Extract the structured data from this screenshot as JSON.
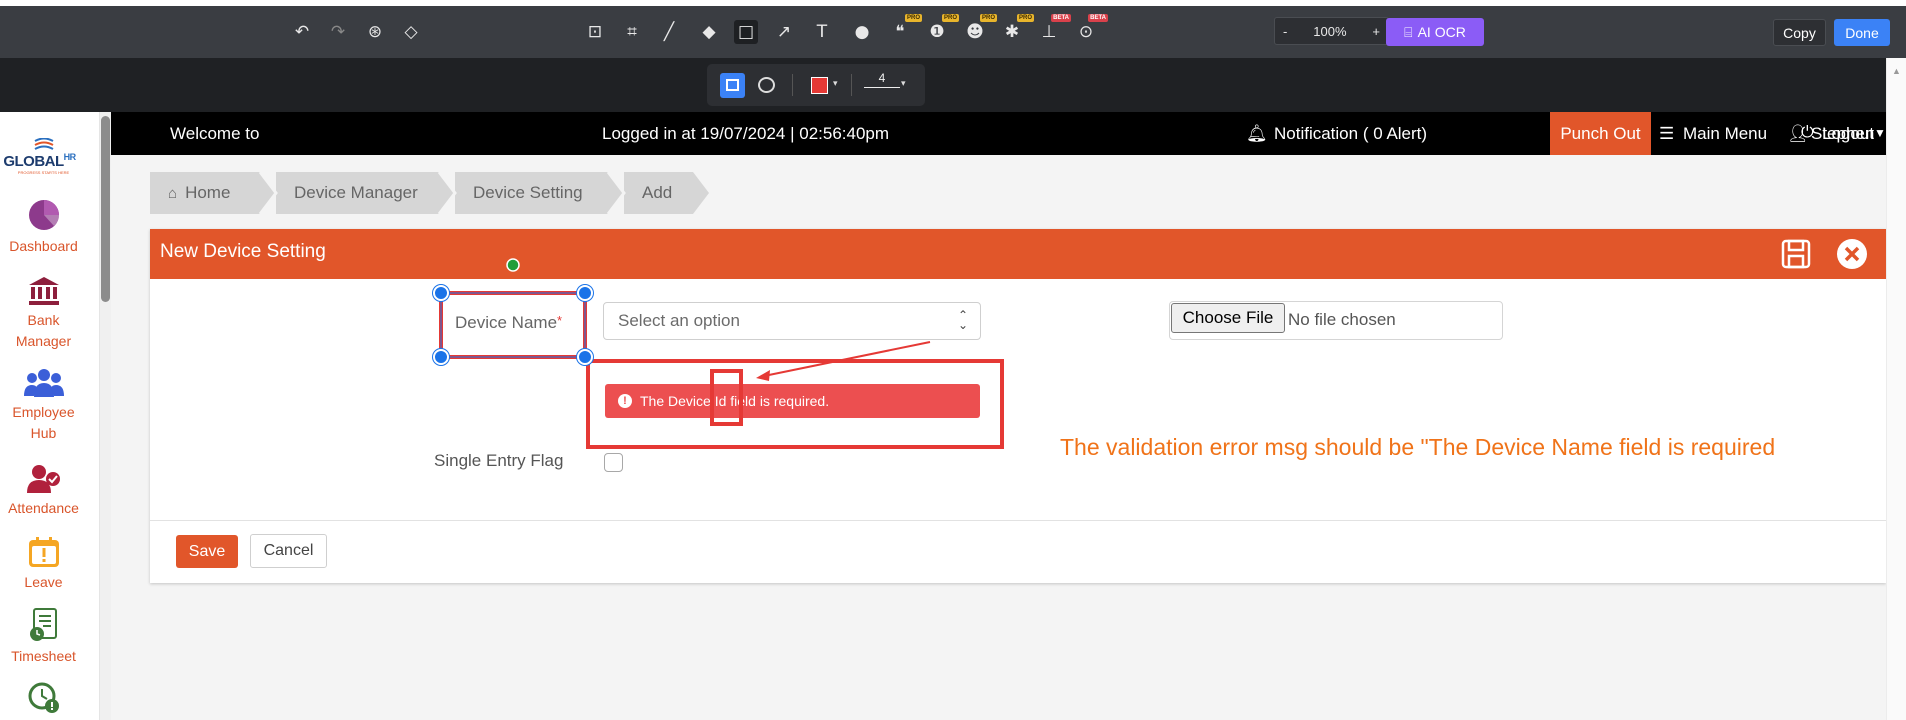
{
  "toolbar": {
    "zoom_minus": "-",
    "zoom_level": "100%",
    "zoom_plus": "+",
    "ai_ocr_label": "AI OCR",
    "copy_label": "Copy",
    "done_label": "Done",
    "pro_badge": "PRO",
    "beta_badge": "BETA",
    "stroke_width": "4",
    "colors": {
      "bar": "#3a3d42",
      "stroke_color": "#e53935",
      "accent": "#3b82f6",
      "ocr": "#8b5cf6"
    }
  },
  "header": {
    "welcome": "Welcome to",
    "logged_in": "Logged in at 19/07/2024 | 02:56:40pm",
    "notification": "Notification ( 0 Alert)",
    "punch_out": "Punch Out",
    "main_menu": "Main Menu",
    "user": "Stephen",
    "logout": "Logout"
  },
  "logo": {
    "text": "GLOBAL",
    "sup": "HR"
  },
  "sidebar": {
    "items": [
      {
        "label": "Dashboard",
        "icon": "pie-chart-icon"
      },
      {
        "label": "Bank Manager",
        "icon": "bank-icon"
      },
      {
        "label": "Employee Hub",
        "icon": "users-icon"
      },
      {
        "label": "Attendance",
        "icon": "user-check-icon"
      },
      {
        "label": "Leave",
        "icon": "calendar-alert-icon"
      },
      {
        "label": "Timesheet",
        "icon": "timesheet-icon"
      },
      {
        "label": "",
        "icon": "clock-alert-icon"
      }
    ]
  },
  "breadcrumb": [
    "Home",
    "Device Manager",
    "Device Setting",
    "Add"
  ],
  "form": {
    "title": "New Device Setting",
    "device_name_label": "Device Name",
    "required_mark": "*",
    "select_placeholder": "Select an option",
    "choose_file": "Choose File",
    "no_file": "No file chosen",
    "error_message": "The Device Id field is required.",
    "single_entry_label": "Single Entry Flag",
    "save_label": "Save",
    "cancel_label": "Cancel"
  },
  "annotation": {
    "note": "The validation error msg should be \"The Device Name field is required",
    "color": "#e53935",
    "note_color": "#f07319"
  }
}
